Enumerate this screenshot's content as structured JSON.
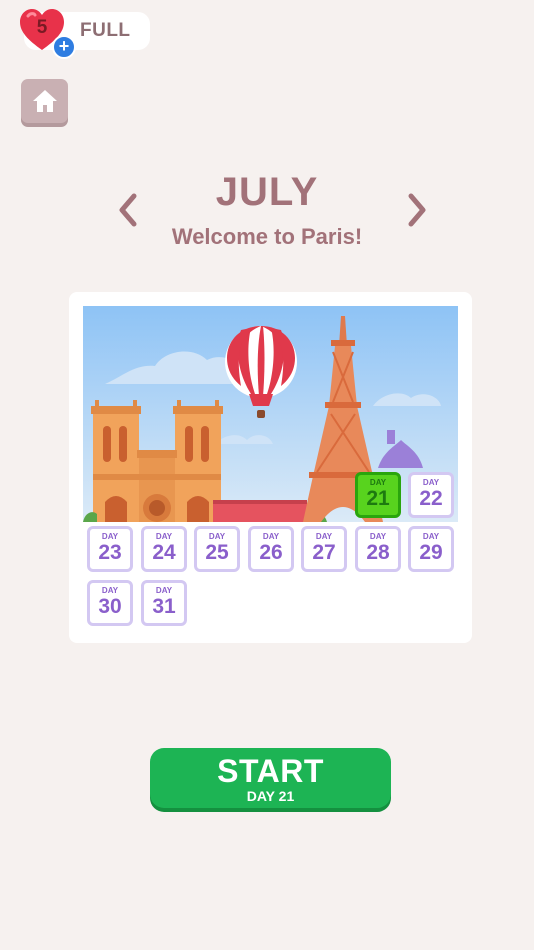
{
  "lives": {
    "count": "5",
    "status": "FULL"
  },
  "header": {
    "month": "JULY",
    "subtitle": "Welcome to Paris!"
  },
  "calendar": {
    "day_label": "DAY",
    "current_day": 21,
    "days": [
      21,
      22,
      23,
      24,
      25,
      26,
      27,
      28,
      29,
      30,
      31
    ]
  },
  "start": {
    "label": "START",
    "sublabel": "DAY 21"
  },
  "colors": {
    "background": "#f6f1ef",
    "accent_text": "#a27279",
    "start_green": "#1db454",
    "current_day_green": "#58d31e",
    "day_purple": "#8a5fcb"
  },
  "icons": [
    "heart-icon",
    "plus-icon",
    "home-icon",
    "chevron-left-icon",
    "chevron-right-icon"
  ]
}
